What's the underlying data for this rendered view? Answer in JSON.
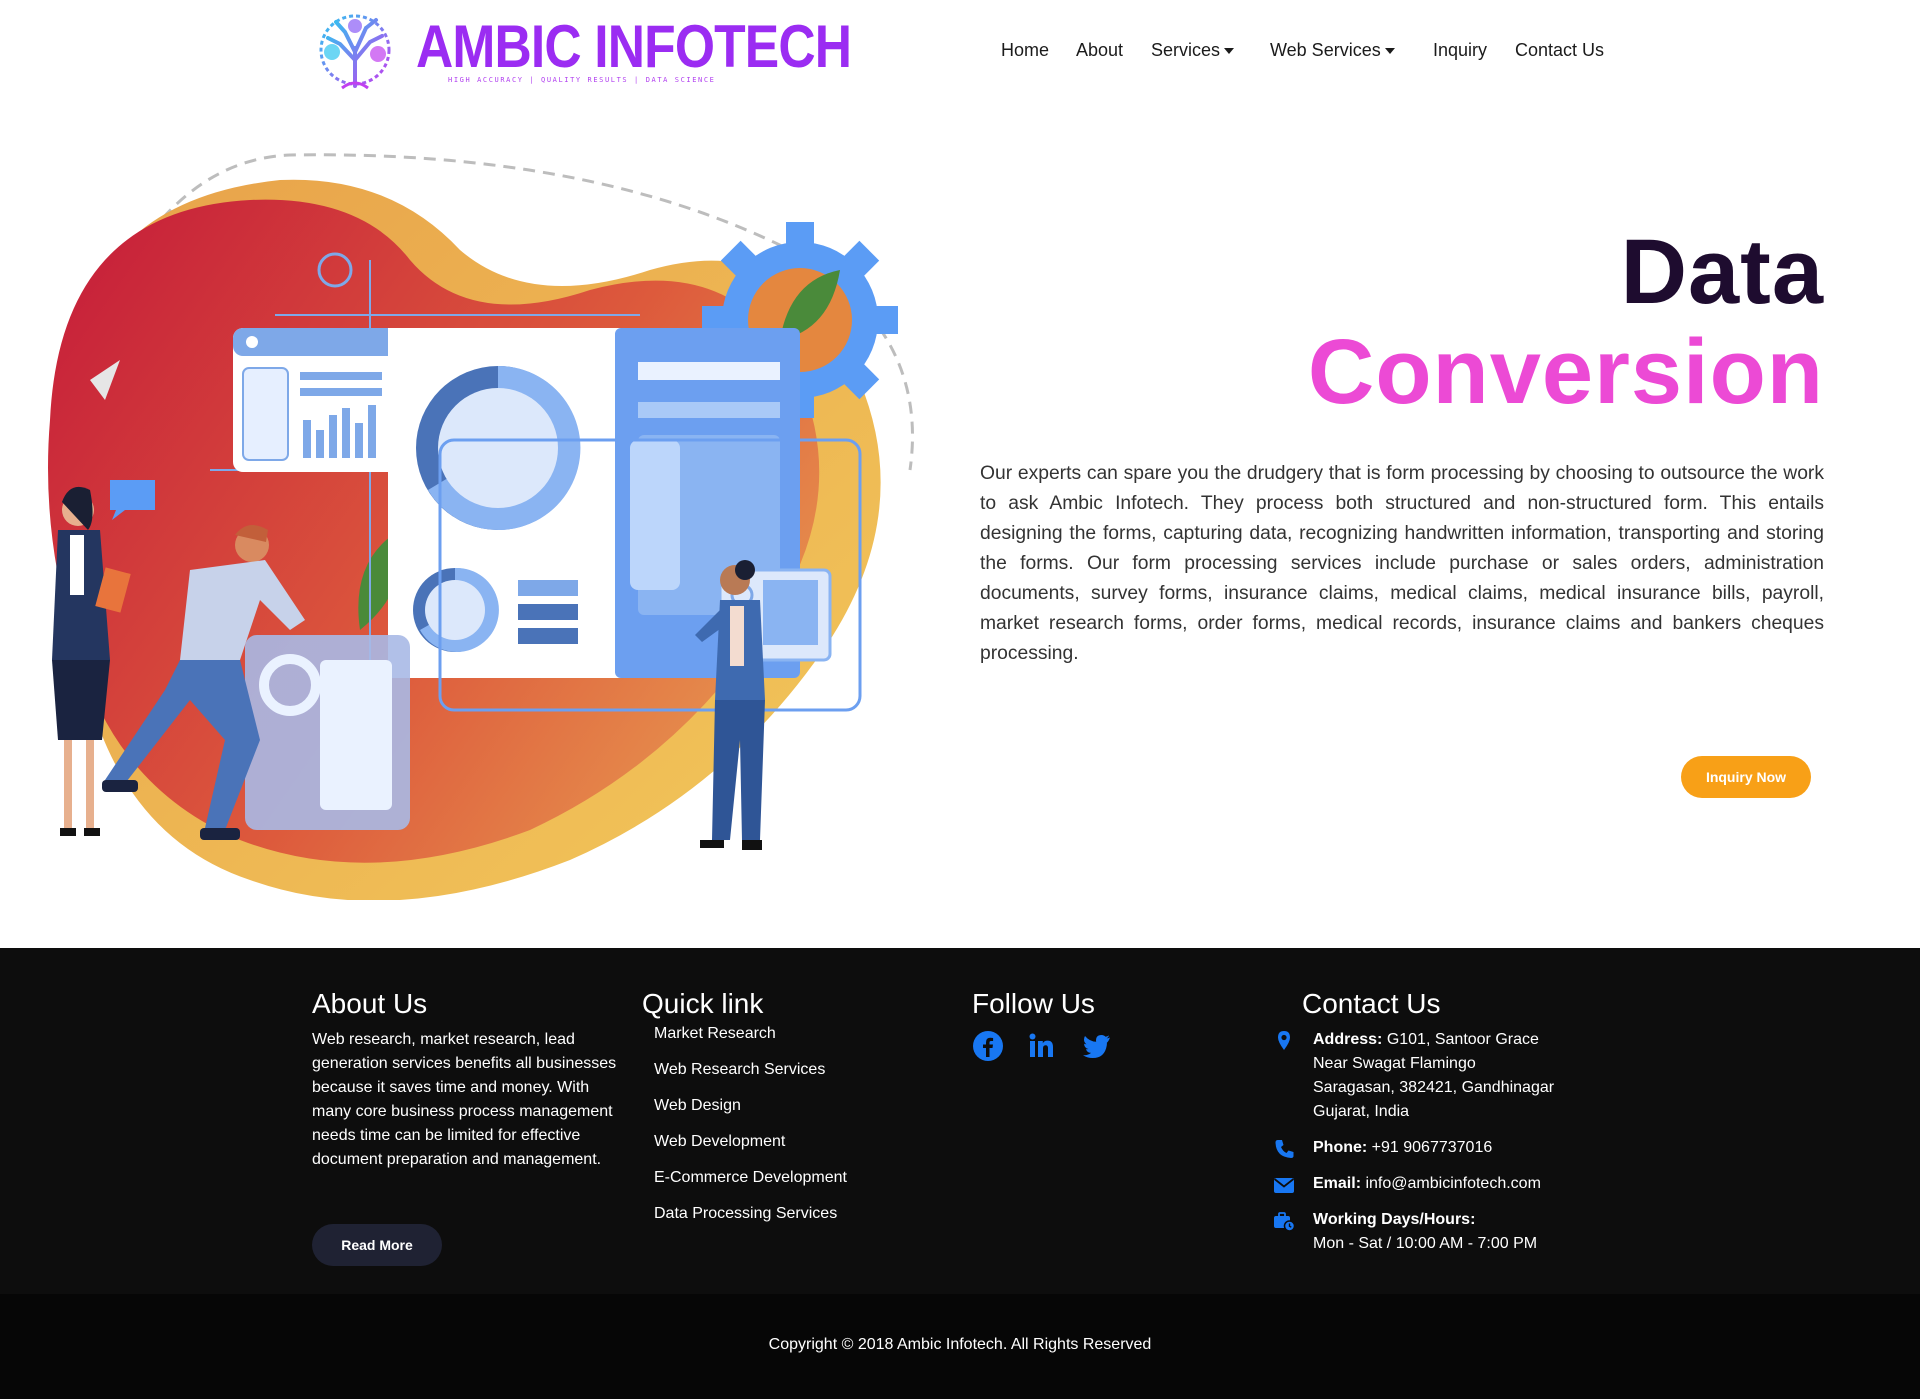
{
  "brand": {
    "name": "AMBIC INFOTECH",
    "tagline": "HIGH ACCURACY | QUALITY RESULTS | DATA SCIENCE"
  },
  "nav": {
    "home": "Home",
    "about": "About",
    "services": "Services",
    "web_services": "Web Services",
    "inquiry": "Inquiry",
    "contact": "Contact Us"
  },
  "hero": {
    "title_line1": "Data",
    "title_line2": "Conversion",
    "description": "Our experts can spare you the drudgery that is form processing by choosing to outsource the work to ask Ambic Infotech. They process both structured and non-structured form. This entails designing the forms, capturing data, recognizing handwritten information, transporting and storing the forms. Our form processing services include purchase or sales orders, administration documents, survey forms, insurance claims, medical claims, medical insurance bills, payroll, market research forms, order forms, medical records, insurance claims and bankers cheques processing.",
    "cta": "Inquiry Now"
  },
  "footer": {
    "about": {
      "heading": "About Us",
      "text": "Web research, market research, lead generation services benefits all businesses because it saves time and money. With many core business process management needs time can be limited for effective document preparation and management.",
      "button": "Read More"
    },
    "quick": {
      "heading": "Quick link",
      "links": [
        "Market Research",
        "Web Research Services",
        "Web Design",
        "Web Development",
        "E-Commerce Development",
        "Data Processing Services"
      ]
    },
    "follow": {
      "heading": "Follow Us",
      "icons": [
        "facebook-icon",
        "linkedin-icon",
        "twitter-icon"
      ]
    },
    "contact": {
      "heading": "Contact Us",
      "address_label": "Address:",
      "address_line1": "G101, Santoor Grace",
      "address_line2": "Near Swagat Flamingo",
      "address_line3": "Saragasan, 382421, Gandhinagar",
      "address_line4": "Gujarat, India",
      "phone_label": "Phone:",
      "phone": "+91 9067737016",
      "email_label": "Email:",
      "email": "info@ambicinfotech.com",
      "hours_label": "Working Days/Hours:",
      "hours": "Mon - Sat / 10:00 AM - 7:00 PM"
    },
    "copyright": "Copyright © 2018 Ambic Infotech. All Rights Reserved"
  },
  "colors": {
    "accent_pink": "#ec4ad5",
    "title_dark": "#1e0c2f",
    "cta_orange": "#f8a017",
    "footer_bg": "#0d0d0d",
    "icon_blue": "#1877f2",
    "brand_purple": "#9b2cf2"
  }
}
